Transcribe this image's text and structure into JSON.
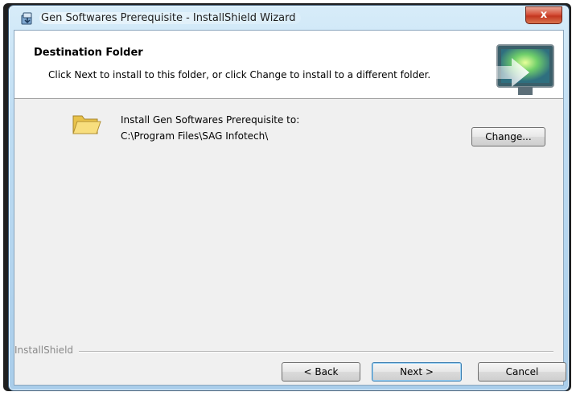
{
  "window": {
    "title": "Gen Softwares Prerequisite - InstallShield Wizard",
    "close_label": "x"
  },
  "banner": {
    "title": "Destination Folder",
    "description": "Click Next to install to this folder, or click Change to install to a different folder."
  },
  "destination": {
    "label": "Install Gen Softwares Prerequisite to:",
    "path": "C:\\Program Files\\SAG Infotech\\",
    "change_label": "Change..."
  },
  "footer": {
    "brand": "InstallShield",
    "back_label": "< Back",
    "next_label": "Next >",
    "cancel_label": "Cancel"
  },
  "icons": {
    "app": "installer-icon",
    "folder": "folder-icon",
    "banner": "monitor-arrow-graphic"
  },
  "colors": {
    "accent": "#3c7fb1",
    "close": "#c3361f",
    "banner_bg": "#ffffff",
    "dialog_bg": "#f0f0f0"
  }
}
